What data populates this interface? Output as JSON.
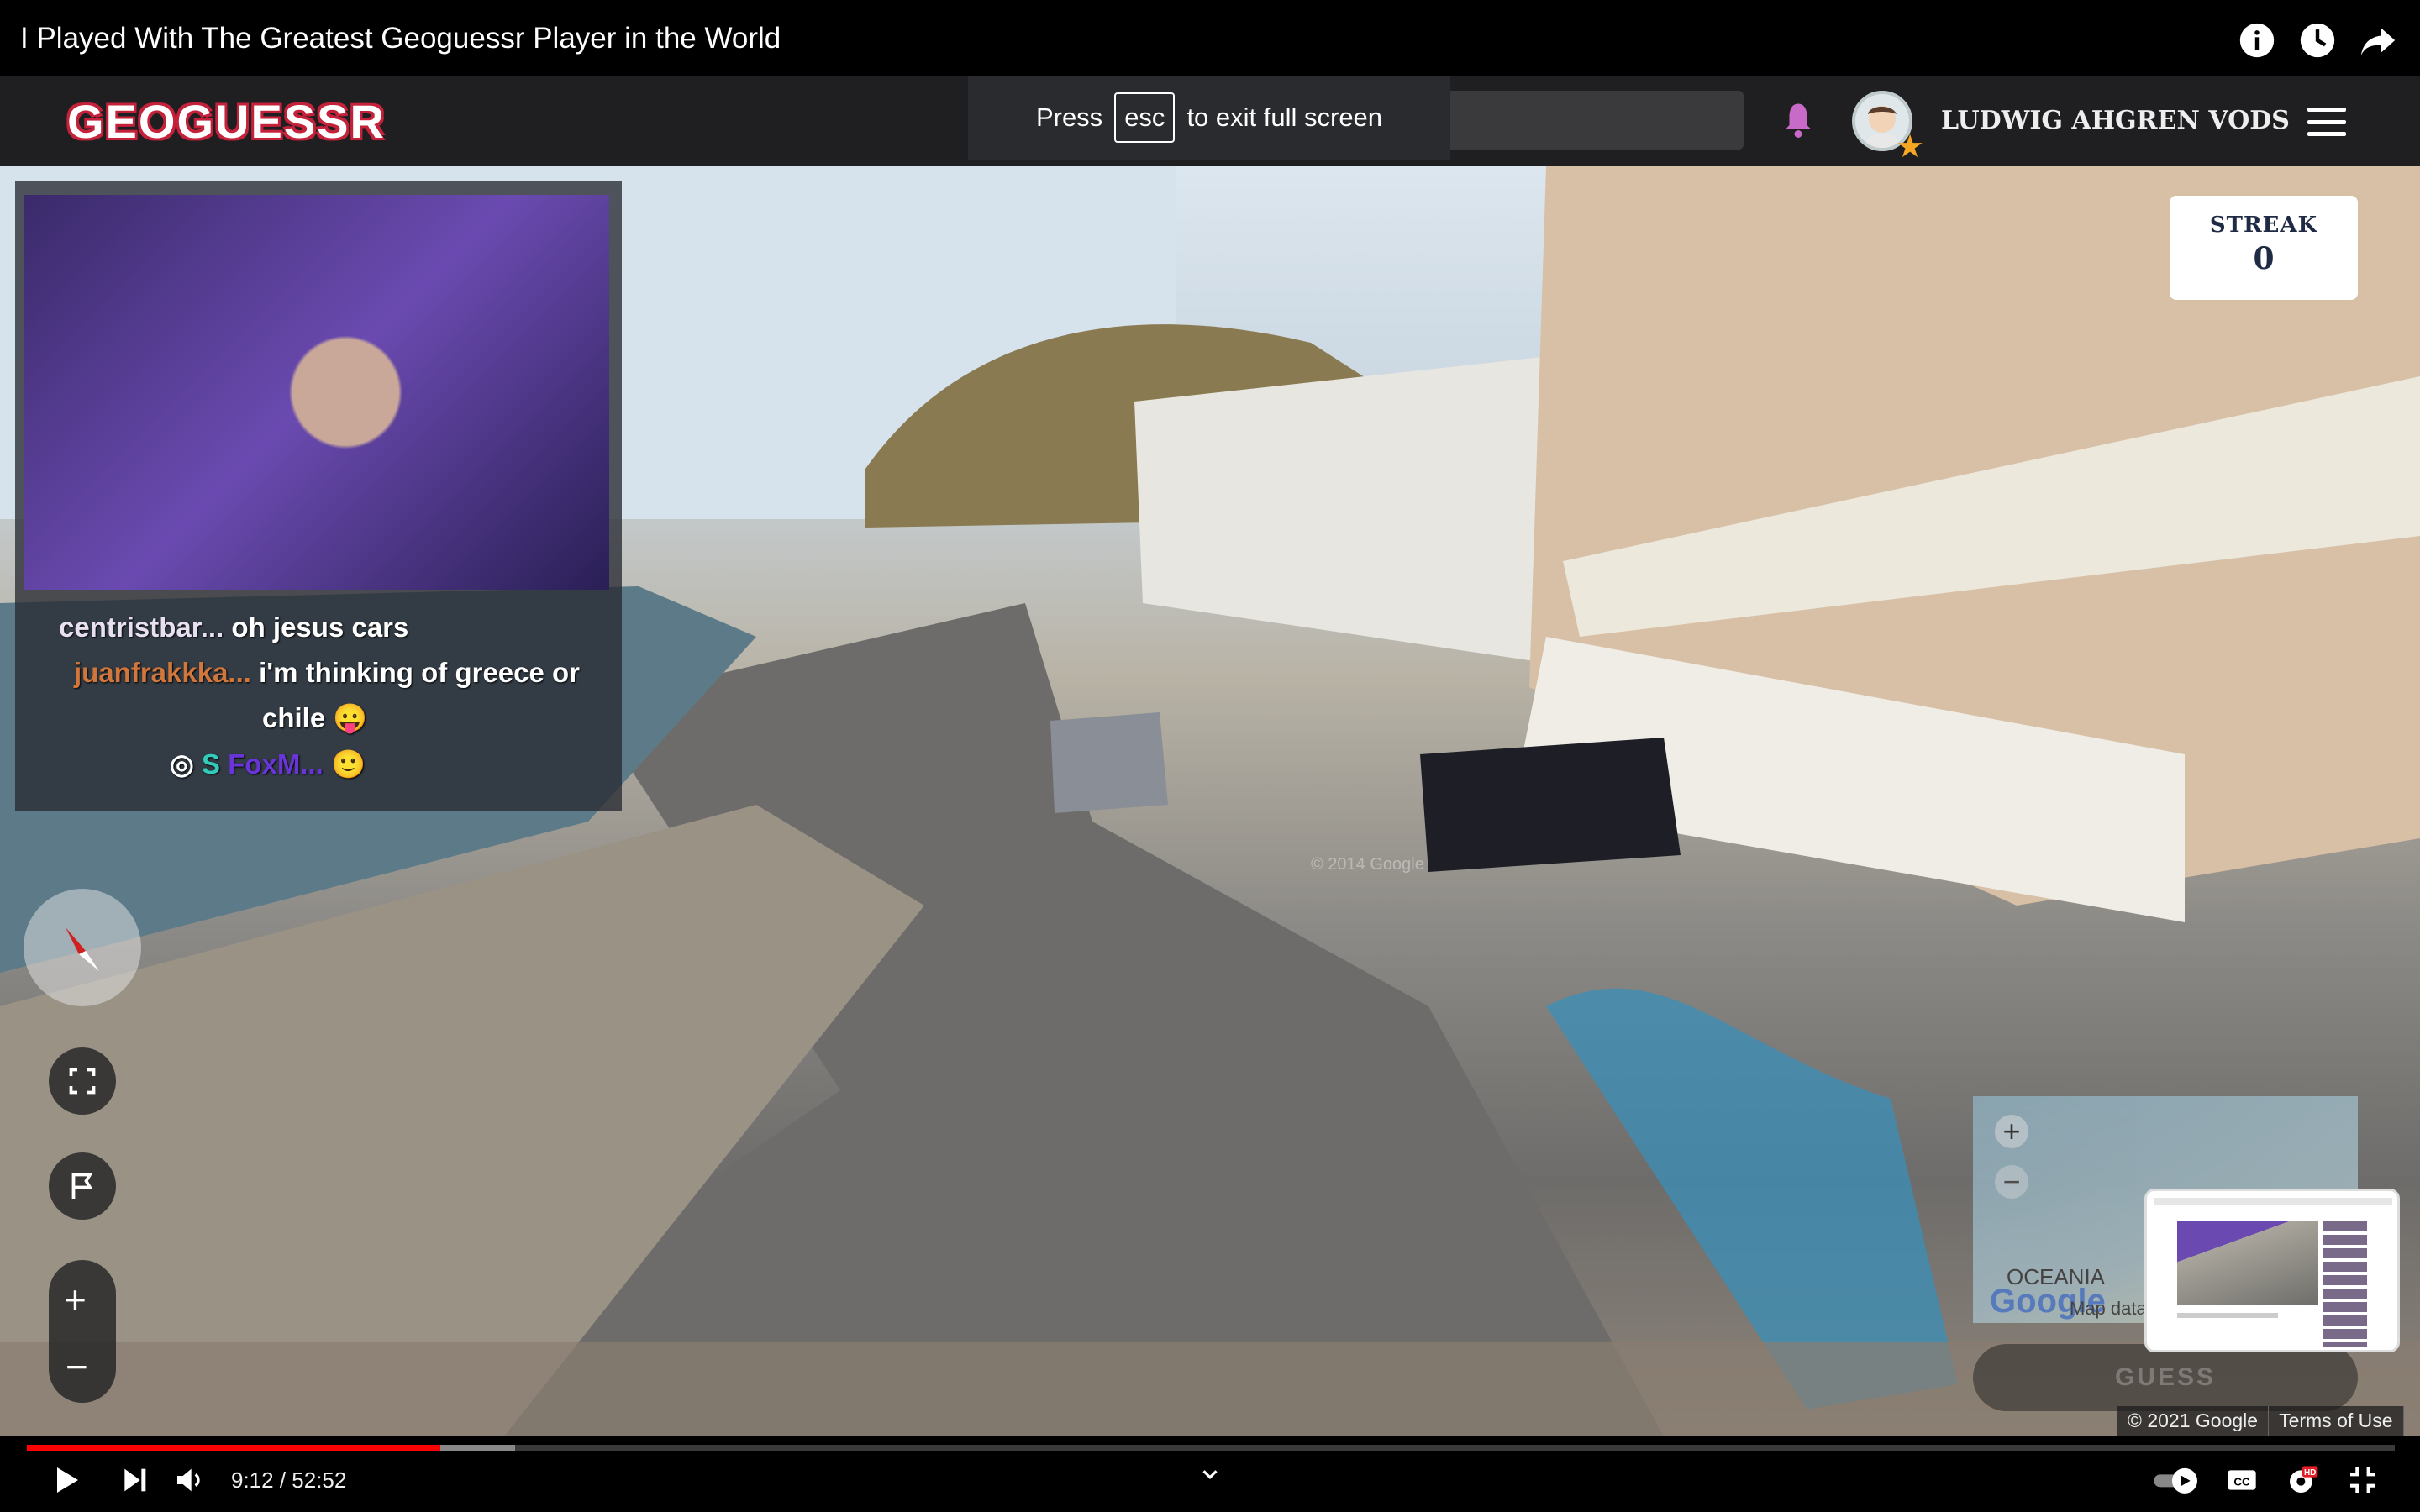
{
  "video": {
    "title": "I Played With The Greatest Geoguessr Player in the World",
    "current_time": "9:12",
    "duration": "52:52",
    "time_display": "9:12 / 52:52",
    "played_fraction": 0.1745,
    "buffered_fraction": 0.206,
    "accent_color": "#ff0000"
  },
  "fullscreen_toast": {
    "press": "Press",
    "key": "esc",
    "suffix": "to exit full screen"
  },
  "geoguessr": {
    "logo": "GEOGUESSR",
    "username": "LUDWIG AHGREN VODS",
    "streak_label": "STREAK",
    "streak_value": "0",
    "guess_label": "GUESS",
    "map_label": "OCEANIA",
    "map_data": "Map data",
    "google_logo": "Google",
    "copyright": "© 2021 Google",
    "terms": "Terms of Use",
    "watermark": "© 2014 Google"
  },
  "chat": [
    {
      "user": "centristbar...",
      "message": "oh jesus cars",
      "user_color": "#e8e0f0"
    },
    {
      "user": "juanfrakkka...",
      "message": "i'm thinking of greece or",
      "user_color": "#d2773c"
    },
    {
      "user": "",
      "message": "chile",
      "user_color": "#ffffff"
    },
    {
      "user": "FoxM...",
      "message": "",
      "user_color": "#6a35d8"
    }
  ],
  "icons": [
    "info-icon",
    "clock-icon",
    "share-icon",
    "bell-icon",
    "menu-icon",
    "compass-icon",
    "fullscreen-icon",
    "flag-icon",
    "zoom-in-icon",
    "zoom-out-icon",
    "play-icon",
    "next-icon",
    "volume-icon",
    "chevron-down-icon",
    "autoplay-toggle-icon",
    "captions-icon",
    "settings-icon",
    "exit-fullscreen-icon"
  ],
  "colors": {
    "logo_red": "#c4213a",
    "bell": "#c86bc8",
    "hd_badge": "#e31b23"
  }
}
